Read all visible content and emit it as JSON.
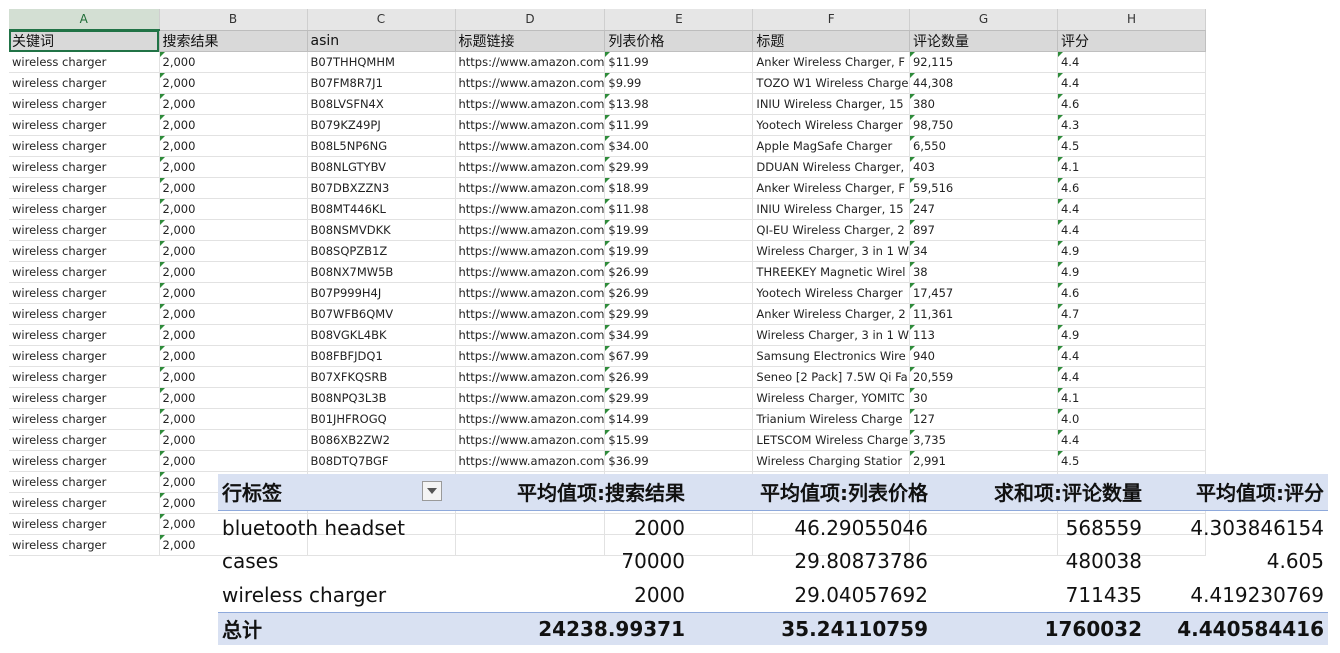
{
  "sheet": {
    "columns": [
      "A",
      "B",
      "C",
      "D",
      "E",
      "F",
      "G",
      "H"
    ],
    "headers": [
      "关键词",
      "搜索结果",
      "asin",
      "标题链接",
      "列表价格",
      "标题",
      "评论数量",
      "评分"
    ],
    "rows": [
      [
        "wireless charger",
        "2,000",
        "B07THHQMHM",
        "https://www.amazon.com",
        "$11.99",
        "Anker Wireless Charger, F",
        "92,115",
        "4.4"
      ],
      [
        "wireless charger",
        "2,000",
        "B07FM8R7J1",
        "https://www.amazon.com",
        "$9.99",
        "TOZO W1 Wireless Charge",
        "44,308",
        "4.4"
      ],
      [
        "wireless charger",
        "2,000",
        "B08LVSFN4X",
        "https://www.amazon.com",
        "$13.98",
        "INIU Wireless Charger, 15",
        "380",
        "4.6"
      ],
      [
        "wireless charger",
        "2,000",
        "B079KZ49PJ",
        "https://www.amazon.com",
        "$11.99",
        "Yootech Wireless Charger",
        "98,750",
        "4.3"
      ],
      [
        "wireless charger",
        "2,000",
        "B08L5NP6NG",
        "https://www.amazon.com",
        "$34.00",
        "Apple MagSafe Charger",
        "6,550",
        "4.5"
      ],
      [
        "wireless charger",
        "2,000",
        "B08NLGTYBV",
        "https://www.amazon.com",
        "$29.99",
        "DDUAN Wireless Charger,",
        "403",
        "4.1"
      ],
      [
        "wireless charger",
        "2,000",
        "B07DBXZZN3",
        "https://www.amazon.com",
        "$18.99",
        "Anker Wireless Charger, F",
        "59,516",
        "4.6"
      ],
      [
        "wireless charger",
        "2,000",
        "B08MT446KL",
        "https://www.amazon.com",
        "$11.98",
        "INIU Wireless Charger, 15",
        "247",
        "4.4"
      ],
      [
        "wireless charger",
        "2,000",
        "B08NSMVDKK",
        "https://www.amazon.com",
        "$19.99",
        "QI-EU Wireless Charger, 2",
        "897",
        "4.4"
      ],
      [
        "wireless charger",
        "2,000",
        "B08SQPZB1Z",
        "https://www.amazon.com",
        "$19.99",
        "Wireless Charger, 3 in 1 W",
        "34",
        "4.9"
      ],
      [
        "wireless charger",
        "2,000",
        "B08NX7MW5B",
        "https://www.amazon.com",
        "$26.99",
        "THREEKEY Magnetic Wirel",
        "38",
        "4.9"
      ],
      [
        "wireless charger",
        "2,000",
        "B07P999H4J",
        "https://www.amazon.com",
        "$26.99",
        "Yootech Wireless Charger",
        "17,457",
        "4.6"
      ],
      [
        "wireless charger",
        "2,000",
        "B07WFB6QMV",
        "https://www.amazon.com",
        "$29.99",
        "Anker Wireless Charger, 2",
        "11,361",
        "4.7"
      ],
      [
        "wireless charger",
        "2,000",
        "B08VGKL4BK",
        "https://www.amazon.com",
        "$34.99",
        "Wireless Charger, 3 in 1 W",
        "113",
        "4.9"
      ],
      [
        "wireless charger",
        "2,000",
        "B08FBFJDQ1",
        "https://www.amazon.com",
        "$67.99",
        "Samsung Electronics Wire",
        "940",
        "4.4"
      ],
      [
        "wireless charger",
        "2,000",
        "B07XFKQSRB",
        "https://www.amazon.com",
        "$26.99",
        "Seneo [2 Pack] 7.5W Qi Fa",
        "20,559",
        "4.4"
      ],
      [
        "wireless charger",
        "2,000",
        "B08NPQ3L3B",
        "https://www.amazon.com",
        "$29.99",
        "Wireless Charger, YOMITC",
        "30",
        "4.1"
      ],
      [
        "wireless charger",
        "2,000",
        "B01JHFROGQ",
        "https://www.amazon.com",
        "$14.99",
        "Trianium Wireless Charge",
        "127",
        "4.0"
      ],
      [
        "wireless charger",
        "2,000",
        "B086XB2ZW2",
        "https://www.amazon.com",
        "$15.99",
        "LETSCOM Wireless Charge",
        "3,735",
        "4.4"
      ],
      [
        "wireless charger",
        "2,000",
        "B08DTQ7BGF",
        "https://www.amazon.com",
        "$36.99",
        "Wireless Charging Statior",
        "2,991",
        "4.5"
      ],
      [
        "wireless charger",
        "2,000",
        "",
        "",
        "",
        "",
        "",
        ""
      ],
      [
        "wireless charger",
        "2,000",
        "",
        "",
        "",
        "",
        "",
        ""
      ],
      [
        "wireless charger",
        "2,000",
        "",
        "",
        "",
        "",
        "",
        ""
      ],
      [
        "wireless charger",
        "2,000",
        "",
        "",
        "",
        "",
        "",
        ""
      ]
    ]
  },
  "pivot": {
    "headers": [
      "行标签",
      "平均值项:搜索结果",
      "平均值项:列表价格",
      "求和项:评论数量",
      "平均值项:评分"
    ],
    "rows": [
      [
        "bluetooth headset",
        "2000",
        "46.29055046",
        "568559",
        "4.303846154"
      ],
      [
        "cases",
        "70000",
        "29.80873786",
        "480038",
        "4.605"
      ],
      [
        "wireless charger",
        "2000",
        "29.04057692",
        "711435",
        "4.419230769"
      ]
    ],
    "total": [
      "总计",
      "24238.99371",
      "35.24110759",
      "1760032",
      "4.440584416"
    ]
  }
}
